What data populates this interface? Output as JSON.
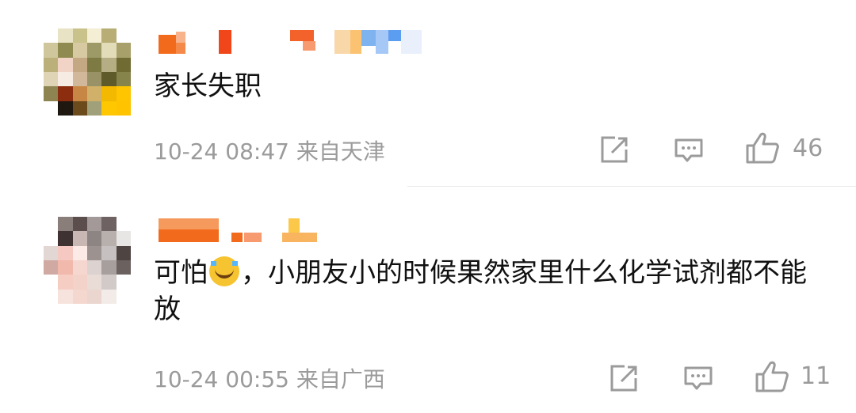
{
  "comments": [
    {
      "text": "家长失职",
      "time": "10-24 08:47",
      "location": "来自天津",
      "likes": "46",
      "username_censored": true,
      "avatar_censored": true
    },
    {
      "text_before_emoji": "可怕",
      "emoji": "laughing-crying-emoji",
      "text_after_emoji": "，小朋友小的时候果然家里什么化学试剂都不能放",
      "time": "10-24 00:55",
      "location": "来自广西",
      "likes": "11",
      "username_censored": true,
      "avatar_censored": true
    }
  ],
  "colors": {
    "text": "#111111",
    "meta": "#9b9b9b",
    "divider": "#e9e9e9",
    "username_orange": "#f26b1d"
  },
  "icons": [
    "share-icon",
    "reply-icon",
    "like-icon"
  ]
}
